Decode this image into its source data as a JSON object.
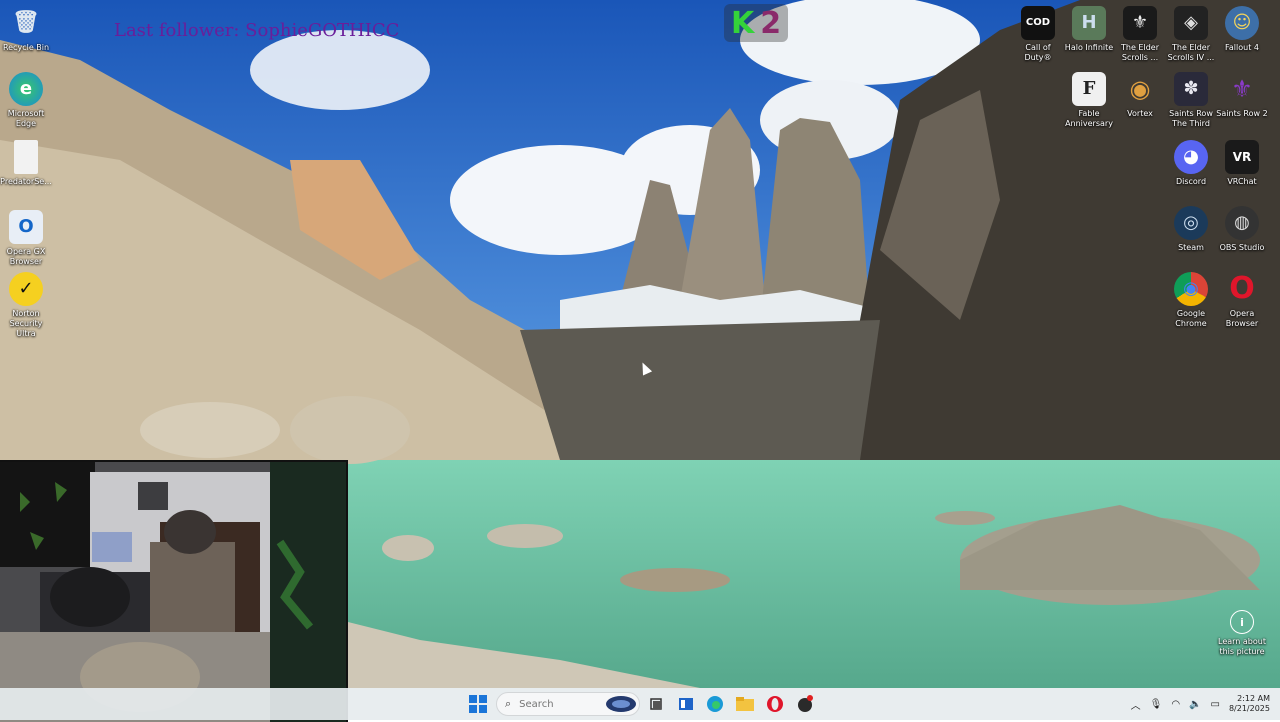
{
  "overlay": {
    "last_follower": "Last follower: SophieGOTHICC"
  },
  "badge": {
    "k": "K",
    "two": "2"
  },
  "desktop_left": [
    {
      "id": "recycle-bin",
      "label": "Recycle Bin",
      "glyph": "🗑"
    },
    {
      "id": "microsoft-edge",
      "label": "Microsoft Edge",
      "glyph": "e"
    },
    {
      "id": "predator-sense",
      "label": "PredatorSe...",
      "glyph": ""
    },
    {
      "id": "opera-gx",
      "label": "Opera GX Browser",
      "glyph": "O"
    },
    {
      "id": "norton",
      "label": "Norton Security Ultra",
      "glyph": "✓"
    }
  ],
  "desktop_right": [
    {
      "id": "call-of-duty",
      "label": "Call of Duty®",
      "glyph": "COD"
    },
    {
      "id": "halo-infinite",
      "label": "Halo Infinite",
      "glyph": "H"
    },
    {
      "id": "skyrim",
      "label": "The Elder Scrolls ...",
      "glyph": "⚜"
    },
    {
      "id": "oblivion",
      "label": "The Elder Scrolls IV ...",
      "glyph": "◈"
    },
    {
      "id": "fallout-4",
      "label": "Fallout 4",
      "glyph": "☺"
    },
    {
      "id": "fable",
      "label": "Fable Anniversary",
      "glyph": "F"
    },
    {
      "id": "vortex",
      "label": "Vortex",
      "glyph": "◉"
    },
    {
      "id": "saints-row-third",
      "label": "Saints Row The Third",
      "glyph": "✽"
    },
    {
      "id": "saints-row-2",
      "label": "Saints Row 2",
      "glyph": "⚜"
    },
    {
      "id": "discord",
      "label": "Discord",
      "glyph": "◕"
    },
    {
      "id": "vrchat",
      "label": "VRChat",
      "glyph": "VR"
    },
    {
      "id": "steam",
      "label": "Steam",
      "glyph": "◎"
    },
    {
      "id": "obs-studio",
      "label": "OBS Studio",
      "glyph": "◍"
    },
    {
      "id": "google-chrome",
      "label": "Google Chrome",
      "glyph": "◉"
    },
    {
      "id": "opera-browser",
      "label": "Opera Browser",
      "glyph": "O"
    }
  ],
  "learn": {
    "label": "Learn about this picture"
  },
  "taskbar": {
    "search_placeholder": "Search",
    "apps": [
      "windows-start",
      "search-highlight",
      "task-view",
      "widgets",
      "edge",
      "file-explorer",
      "opera",
      "obs"
    ]
  },
  "tray": {
    "time": "2:12 AM",
    "date": "8/21/2025"
  },
  "colors": {
    "overlay_text": "#6a1e9a",
    "k_green": "#34d33a",
    "two_purple": "#8a2a6a",
    "taskbar_bg": "#e6ecee"
  }
}
